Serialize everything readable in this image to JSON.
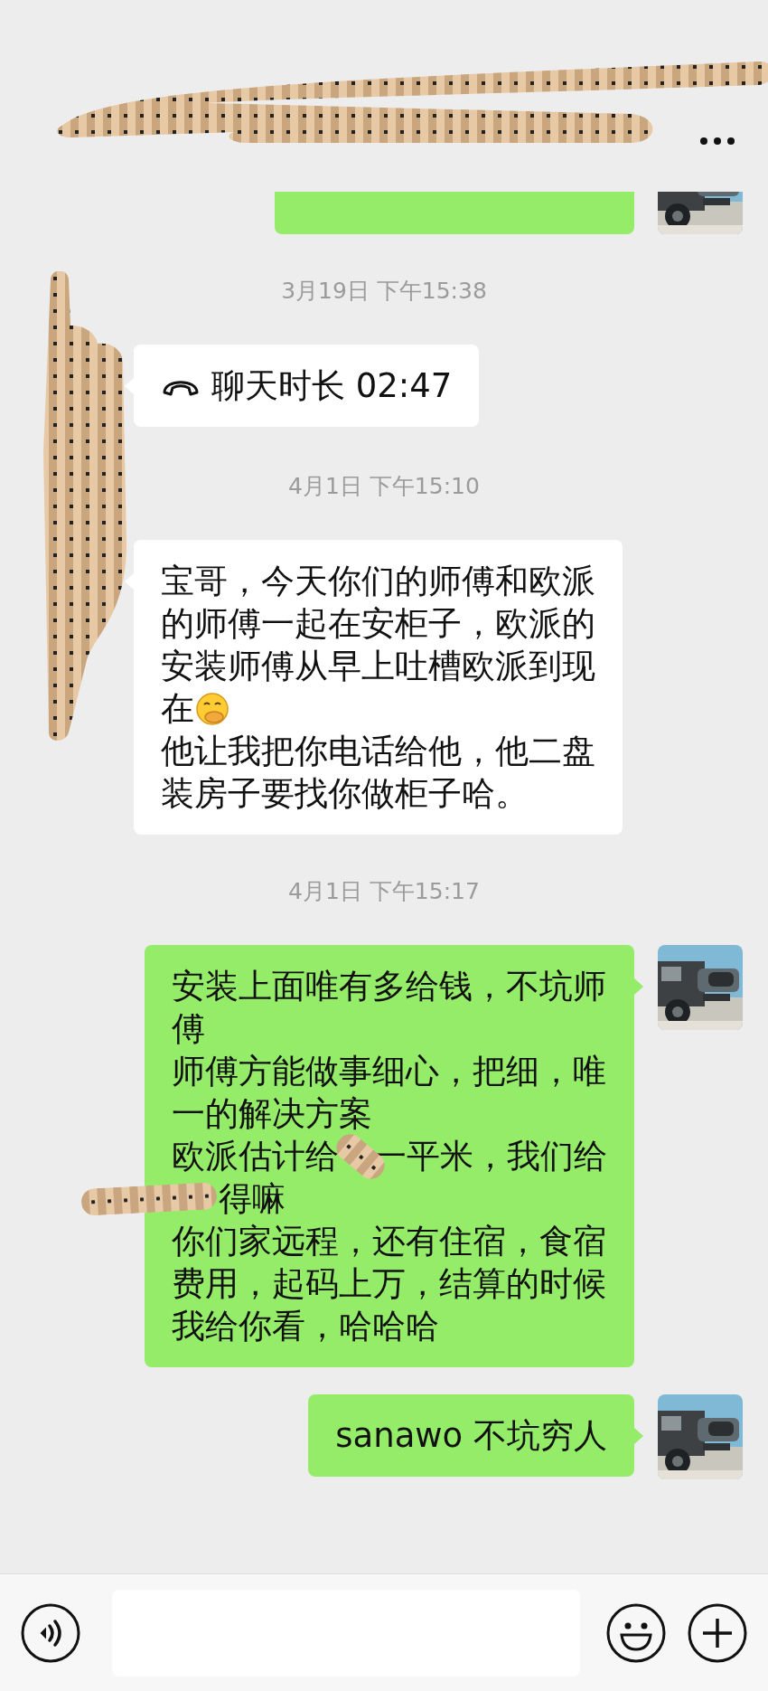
{
  "messages": [
    {
      "kind": "clipped",
      "outgoing": true
    },
    {
      "kind": "time",
      "text": "3月19日 下午15:38"
    },
    {
      "kind": "call",
      "outgoing": false,
      "text": "聊天时长 02:47"
    },
    {
      "kind": "time",
      "text": "4月1日 下午15:10"
    },
    {
      "kind": "text",
      "outgoing": false,
      "lines": [
        [
          {
            "kind": "text",
            "text": "宝哥，今天你们的师傅和欧派"
          }
        ],
        [
          {
            "kind": "text",
            "text": "的师傅一起在安柜子，欧派的"
          }
        ],
        [
          {
            "kind": "text",
            "text": "安装师傅从早上吐槽欧派到现"
          }
        ],
        [
          {
            "kind": "text",
            "text": "在"
          },
          {
            "kind": "emoji"
          }
        ],
        [
          {
            "kind": "text",
            "text": "他让我把你电话给他，他二盘"
          }
        ],
        [
          {
            "kind": "text",
            "text": "装房子要找你做柜子哈。"
          }
        ]
      ]
    },
    {
      "kind": "time",
      "text": "4月1日 下午15:17"
    },
    {
      "kind": "text",
      "outgoing": true,
      "lines": [
        [
          {
            "kind": "text",
            "text": "安装上面唯有多给钱，不坑师"
          }
        ],
        [
          {
            "kind": "text",
            "text": "傅"
          }
        ],
        [
          {
            "kind": "text",
            "text": "师傅方能做事细心，把细，唯"
          }
        ],
        [
          {
            "kind": "text",
            "text": "一的解决方案"
          }
        ],
        [
          {
            "kind": "text",
            "text": "欧派估计给"
          },
          {
            "kind": "redaction"
          },
          {
            "kind": "text",
            "text": "一平米，我们给"
          }
        ],
        [
          {
            "kind": "redaction"
          },
          {
            "kind": "text",
            "text": "得嘛"
          }
        ],
        [
          {
            "kind": "text",
            "text": "你们家远程，还有住宿，食宿"
          }
        ],
        [
          {
            "kind": "text",
            "text": "费用，起码上万，结算的时候"
          }
        ],
        [
          {
            "kind": "text",
            "text": "我给你看，哈哈哈"
          }
        ]
      ]
    },
    {
      "kind": "text",
      "outgoing": true,
      "lines": [
        [
          {
            "kind": "text",
            "text": "sanawo 不坑穷人"
          }
        ]
      ]
    }
  ]
}
